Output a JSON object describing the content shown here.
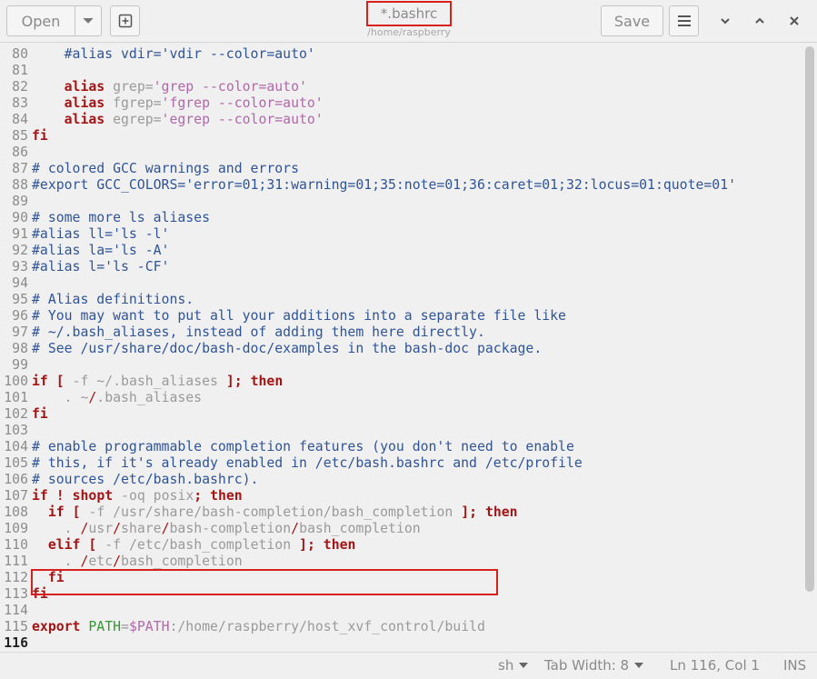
{
  "header": {
    "open_label": "Open",
    "save_label": "Save",
    "title": "*.bashrc",
    "subtitle": "/home/raspberry"
  },
  "editor": {
    "lines": [
      {
        "n": "80",
        "segs": [
          {
            "t": "    #alias vdir='vdir --color=auto'",
            "c": "c"
          }
        ]
      },
      {
        "n": "81",
        "segs": []
      },
      {
        "n": "82",
        "segs": [
          {
            "t": "    ",
            "c": "n"
          },
          {
            "t": "alias",
            "c": "k"
          },
          {
            "t": " grep=",
            "c": "d"
          },
          {
            "t": "'grep --color=auto'",
            "c": "s"
          }
        ]
      },
      {
        "n": "83",
        "segs": [
          {
            "t": "    ",
            "c": "n"
          },
          {
            "t": "alias",
            "c": "k"
          },
          {
            "t": " fgrep=",
            "c": "d"
          },
          {
            "t": "'fgrep --color=auto'",
            "c": "s"
          }
        ]
      },
      {
        "n": "84",
        "segs": [
          {
            "t": "    ",
            "c": "n"
          },
          {
            "t": "alias",
            "c": "k"
          },
          {
            "t": " egrep=",
            "c": "d"
          },
          {
            "t": "'egrep --color=auto'",
            "c": "s"
          }
        ]
      },
      {
        "n": "85",
        "segs": [
          {
            "t": "fi",
            "c": "k"
          }
        ]
      },
      {
        "n": "86",
        "segs": []
      },
      {
        "n": "87",
        "segs": [
          {
            "t": "# colored GCC warnings and errors",
            "c": "c"
          }
        ]
      },
      {
        "n": "88",
        "segs": [
          {
            "t": "#export GCC_COLORS='error=01;31:warning=01;35:note=01;36:caret=01;32:locus=01:quote=01'",
            "c": "c"
          }
        ]
      },
      {
        "n": "89",
        "segs": []
      },
      {
        "n": "90",
        "segs": [
          {
            "t": "# some more ls aliases",
            "c": "c"
          }
        ]
      },
      {
        "n": "91",
        "segs": [
          {
            "t": "#alias ll='ls -l'",
            "c": "c"
          }
        ]
      },
      {
        "n": "92",
        "segs": [
          {
            "t": "#alias la='ls -A'",
            "c": "c"
          }
        ]
      },
      {
        "n": "93",
        "segs": [
          {
            "t": "#alias l='ls -CF'",
            "c": "c"
          }
        ]
      },
      {
        "n": "94",
        "segs": []
      },
      {
        "n": "95",
        "segs": [
          {
            "t": "# Alias definitions.",
            "c": "c"
          }
        ]
      },
      {
        "n": "96",
        "segs": [
          {
            "t": "# You may want to put all your additions into a separate file like",
            "c": "c"
          }
        ]
      },
      {
        "n": "97",
        "segs": [
          {
            "t": "# ~/.bash_aliases, instead of adding them here directly.",
            "c": "c"
          }
        ]
      },
      {
        "n": "98",
        "segs": [
          {
            "t": "# See /usr/share/doc/bash-doc/examples in the bash-doc package.",
            "c": "c"
          }
        ]
      },
      {
        "n": "99",
        "segs": []
      },
      {
        "n": "100",
        "segs": [
          {
            "t": "if",
            "c": "k"
          },
          {
            "t": " ",
            "c": "n"
          },
          {
            "t": "[",
            "c": "k"
          },
          {
            "t": " -f ~/.bash_aliases ",
            "c": "d"
          },
          {
            "t": "];",
            "c": "k"
          },
          {
            "t": " ",
            "c": "n"
          },
          {
            "t": "then",
            "c": "k"
          }
        ]
      },
      {
        "n": "101",
        "segs": [
          {
            "t": "    . ~",
            "c": "d"
          },
          {
            "t": "/",
            "c": "r"
          },
          {
            "t": ".bash_aliases",
            "c": "d"
          }
        ]
      },
      {
        "n": "102",
        "segs": [
          {
            "t": "fi",
            "c": "k"
          }
        ]
      },
      {
        "n": "103",
        "segs": []
      },
      {
        "n": "104",
        "segs": [
          {
            "t": "# enable programmable completion features (you don't need to enable",
            "c": "c"
          }
        ]
      },
      {
        "n": "105",
        "segs": [
          {
            "t": "# this, if it's already enabled in /etc/bash.bashrc and /etc/profile",
            "c": "c"
          }
        ]
      },
      {
        "n": "106",
        "segs": [
          {
            "t": "# sources /etc/bash.bashrc).",
            "c": "c"
          }
        ]
      },
      {
        "n": "107",
        "segs": [
          {
            "t": "if",
            "c": "k"
          },
          {
            "t": " ",
            "c": "n"
          },
          {
            "t": "!",
            "c": "k"
          },
          {
            "t": " ",
            "c": "n"
          },
          {
            "t": "shopt",
            "c": "k"
          },
          {
            "t": " -oq posix",
            "c": "d"
          },
          {
            "t": ";",
            "c": "k"
          },
          {
            "t": " ",
            "c": "n"
          },
          {
            "t": "then",
            "c": "k"
          }
        ]
      },
      {
        "n": "108",
        "segs": [
          {
            "t": "  ",
            "c": "n"
          },
          {
            "t": "if",
            "c": "k"
          },
          {
            "t": " ",
            "c": "n"
          },
          {
            "t": "[",
            "c": "k"
          },
          {
            "t": " -f /usr/share/bash-completion/bash_completion ",
            "c": "d"
          },
          {
            "t": "];",
            "c": "k"
          },
          {
            "t": " ",
            "c": "n"
          },
          {
            "t": "then",
            "c": "k"
          }
        ]
      },
      {
        "n": "109",
        "segs": [
          {
            "t": "    . ",
            "c": "d"
          },
          {
            "t": "/",
            "c": "r"
          },
          {
            "t": "usr",
            "c": "d"
          },
          {
            "t": "/",
            "c": "r"
          },
          {
            "t": "share",
            "c": "d"
          },
          {
            "t": "/",
            "c": "r"
          },
          {
            "t": "bash-completion",
            "c": "d"
          },
          {
            "t": "/",
            "c": "r"
          },
          {
            "t": "bash_completion",
            "c": "d"
          }
        ]
      },
      {
        "n": "110",
        "segs": [
          {
            "t": "  ",
            "c": "n"
          },
          {
            "t": "elif",
            "c": "k"
          },
          {
            "t": " ",
            "c": "n"
          },
          {
            "t": "[",
            "c": "k"
          },
          {
            "t": " -f /etc/bash_completion ",
            "c": "d"
          },
          {
            "t": "];",
            "c": "k"
          },
          {
            "t": " ",
            "c": "n"
          },
          {
            "t": "then",
            "c": "k"
          }
        ]
      },
      {
        "n": "111",
        "segs": [
          {
            "t": "    . ",
            "c": "d"
          },
          {
            "t": "/",
            "c": "r"
          },
          {
            "t": "etc",
            "c": "d"
          },
          {
            "t": "/",
            "c": "r"
          },
          {
            "t": "bash_completion",
            "c": "d"
          }
        ]
      },
      {
        "n": "112",
        "segs": [
          {
            "t": "  ",
            "c": "n"
          },
          {
            "t": "fi",
            "c": "k"
          }
        ]
      },
      {
        "n": "113",
        "segs": [
          {
            "t": "fi",
            "c": "k"
          }
        ]
      },
      {
        "n": "114",
        "segs": []
      },
      {
        "n": "115",
        "segs": [
          {
            "t": "export",
            "c": "k"
          },
          {
            "t": " ",
            "c": "n"
          },
          {
            "t": "PATH",
            "c": "v"
          },
          {
            "t": "=",
            "c": "d"
          },
          {
            "t": "$PATH",
            "c": "s"
          },
          {
            "t": ":/home/raspberry/host_xvf_control/build",
            "c": "d"
          }
        ]
      },
      {
        "n": "116",
        "segs": [],
        "current": true
      }
    ]
  },
  "status": {
    "language": "sh",
    "tab_width": "Tab Width: 8",
    "cursor": "Ln 116, Col 1",
    "mode": "INS"
  }
}
